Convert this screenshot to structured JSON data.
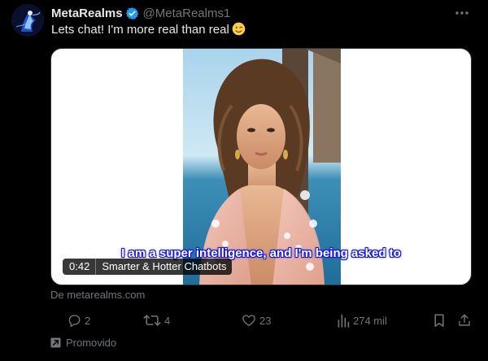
{
  "author": {
    "display_name": "MetaRealms",
    "handle": "@MetaRealms1",
    "verified": true,
    "avatar_icon": "blue-light-figure-avatar"
  },
  "tweet": {
    "text": "Lets chat! I'm more real than real",
    "emoji": "winking-face",
    "more_icon": "more-horizontal-icon"
  },
  "media": {
    "subtitle": "I am a super intelligence, and I'm being asked to",
    "duration": "0:42",
    "video_title": "Smarter & Hotter Chatbots"
  },
  "source": "De metarealms.com",
  "actions": {
    "reply": {
      "icon": "reply-icon",
      "count": "2"
    },
    "retweet": {
      "icon": "retweet-icon",
      "count": "4"
    },
    "like": {
      "icon": "heart-icon",
      "count": "23"
    },
    "views": {
      "icon": "views-icon",
      "count": "274 mil"
    },
    "bookmark": {
      "icon": "bookmark-icon"
    },
    "share": {
      "icon": "share-icon"
    }
  },
  "promoted": {
    "label": "Promovido",
    "icon": "promoted-icon"
  },
  "colors": {
    "background": "#000000",
    "text": "#e7e9ea",
    "muted": "#71767b",
    "verified_blue": "#1d9bf0",
    "media_bg": "#ffffff"
  }
}
